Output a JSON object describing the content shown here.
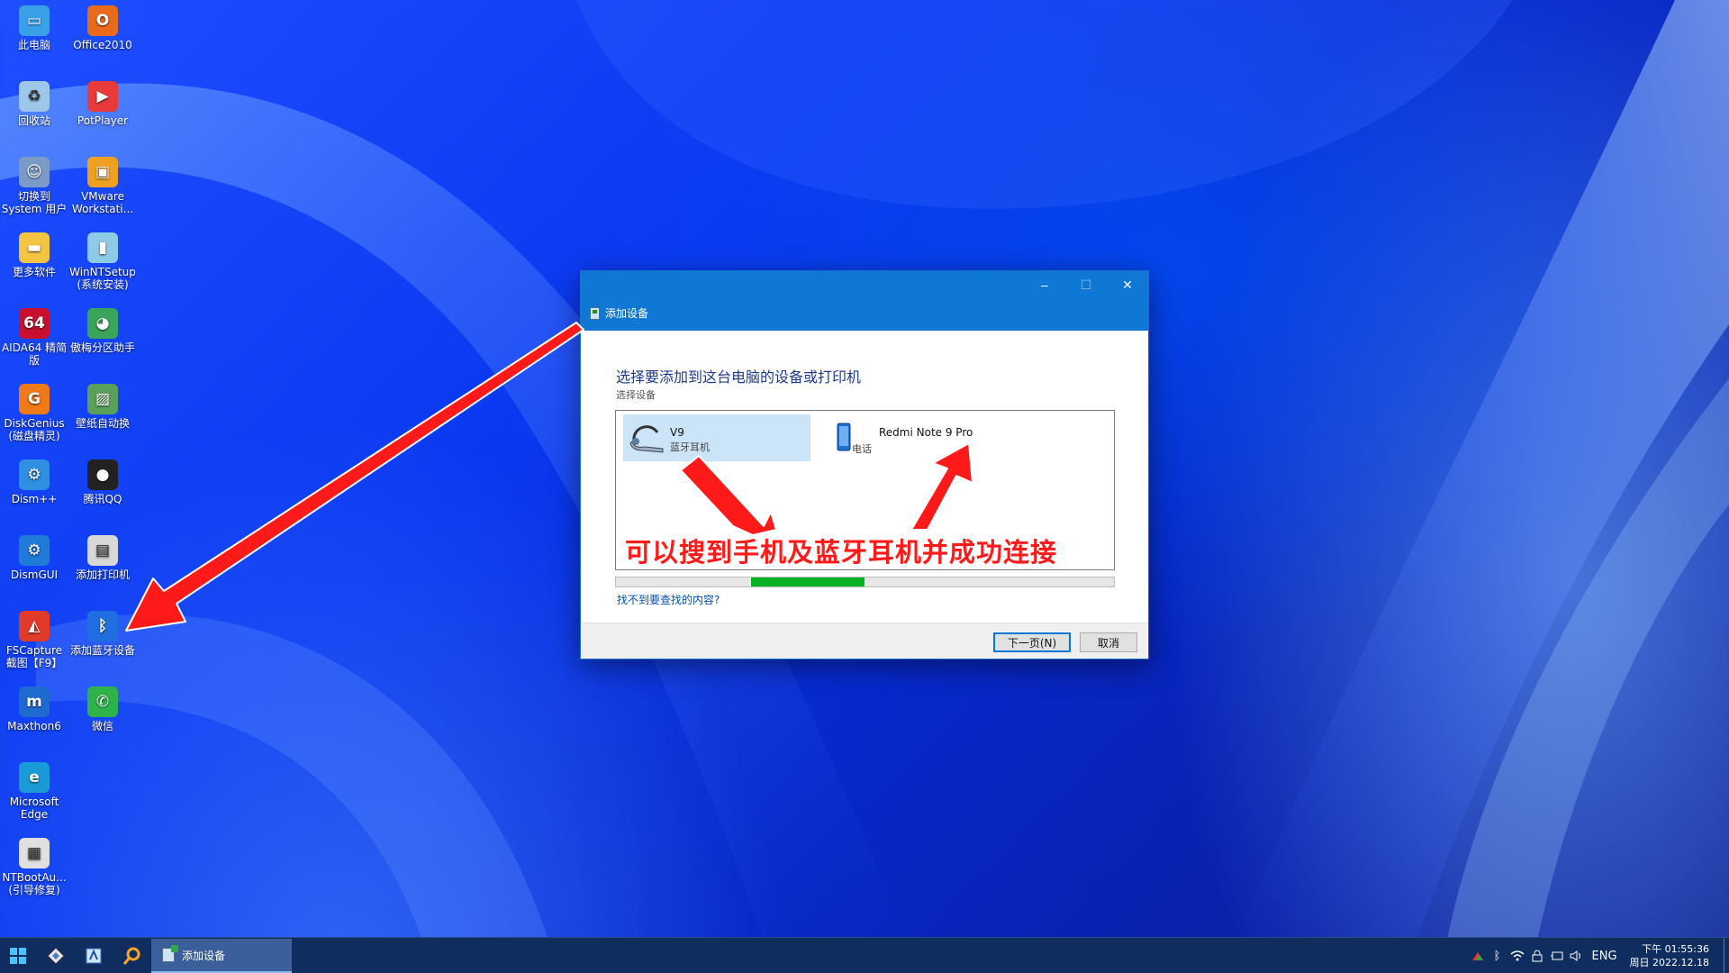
{
  "desktop": {
    "icons": [
      {
        "label": "此电脑",
        "icon": "computer-icon",
        "color": "#3aa0e8"
      },
      {
        "label": "Office2010",
        "icon": "office-icon",
        "color": "#e86a1a"
      },
      {
        "label": "回收站",
        "icon": "recycle-bin-icon",
        "color": "#9ec8ea"
      },
      {
        "label": "PotPlayer",
        "icon": "play-icon",
        "color": "#e83a3a"
      },
      {
        "label": "切换到 System 用户",
        "icon": "users-icon",
        "color": "#7a9ac8"
      },
      {
        "label": "VMware Workstati...",
        "icon": "vmware-icon",
        "color": "#f0a020"
      },
      {
        "label": "更多软件",
        "icon": "folder-icon",
        "color": "#f5c542"
      },
      {
        "label": "WinNTSetup (系统安装)",
        "icon": "setup-icon",
        "color": "#8ecae6"
      },
      {
        "label": "AIDA64 精简版",
        "icon": "aida64-icon",
        "color": "#c8102e"
      },
      {
        "label": "傲梅分区助手",
        "icon": "partition-icon",
        "color": "#3aa55a"
      },
      {
        "label": "DiskGenius (磁盘精灵)",
        "icon": "diskgenius-icon",
        "color": "#f07a1a"
      },
      {
        "label": "壁纸自动换",
        "icon": "wallpaper-icon",
        "color": "#5aa05a"
      },
      {
        "label": "Dism++",
        "icon": "gears-icon",
        "color": "#2f8fe0"
      },
      {
        "label": "腾讯QQ",
        "icon": "qq-icon",
        "color": "#222222"
      },
      {
        "label": "DismGUI",
        "icon": "gear-icon",
        "color": "#1f7ad8"
      },
      {
        "label": "添加打印机",
        "icon": "printer-icon",
        "color": "#d8d8d8"
      },
      {
        "label": "FSCapture 截图【F9】",
        "icon": "capture-icon",
        "color": "#e23a2a"
      },
      {
        "label": "添加蓝牙设备",
        "icon": "bluetooth-icon",
        "color": "#1f6fe0"
      },
      {
        "label": "Maxthon6",
        "icon": "maxthon-icon",
        "color": "#1f6ad0"
      },
      {
        "label": "微信",
        "icon": "wechat-icon",
        "color": "#2db34a"
      },
      {
        "label": "Microsoft Edge",
        "icon": "edge-icon",
        "color": "#1a9bd7"
      },
      {
        "label": "NTBootAu... (引导修复)",
        "icon": "boot-repair-icon",
        "color": "#e0e0e0"
      }
    ]
  },
  "dialog": {
    "window_title": "添加设备",
    "heading": "选择要添加到这台电脑的设备或打印机",
    "subheading": "选择设备",
    "devices": [
      {
        "name": "V9",
        "type": "蓝牙耳机",
        "icon": "headset-icon",
        "selected": true
      },
      {
        "name": "Redmi Note 9 Pro",
        "type": "电话",
        "icon": "phone-icon",
        "selected": false
      }
    ],
    "overlay_text": "可以搜到手机及蓝牙耳机并成功连接",
    "help_link": "找不到要查找的内容?",
    "next_button": "下一页(N)",
    "cancel_button": "取消",
    "controls": {
      "minimize": "–",
      "maximize": "☐",
      "close": "✕"
    }
  },
  "taskbar": {
    "active_app": "添加设备",
    "language": "ENG",
    "time": "下午 01:55:36",
    "date": "周日 2022.12.18"
  },
  "colors": {
    "accent": "#0e78d4",
    "annotation": "#ff1a1a",
    "progress": "#06b025"
  }
}
